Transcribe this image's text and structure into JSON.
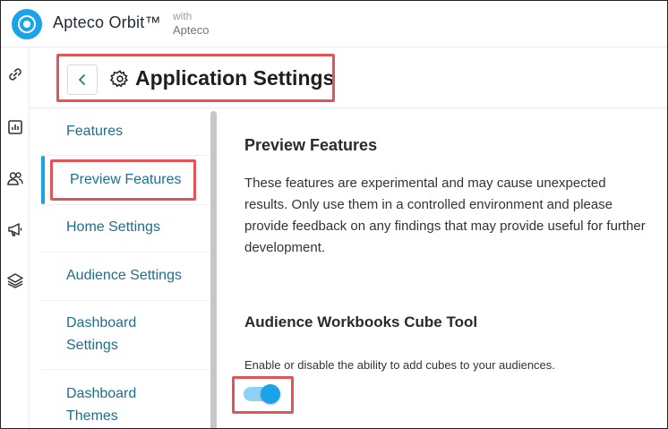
{
  "app": {
    "brand": "Apteco Orbit™",
    "with_label": "with",
    "with_brand": "Apteco",
    "accent_color": "#1aa3e8",
    "highlight_color": "#e05656"
  },
  "rail": {
    "icons": [
      "link-icon",
      "chart-icon",
      "users-icon",
      "megaphone-icon",
      "layers-icon"
    ]
  },
  "header": {
    "back_icon": "chevron-left-icon",
    "settings_icon": "gear-icon",
    "title": "Application Settings"
  },
  "nav": {
    "items": [
      {
        "label": "Features",
        "active": false
      },
      {
        "label": "Preview Features",
        "active": true
      },
      {
        "label": "Home Settings",
        "active": false
      },
      {
        "label": "Audience Settings",
        "active": false
      },
      {
        "label_line1": "Dashboard",
        "label_line2": "Settings",
        "active": false
      },
      {
        "label_line1": "Dashboard",
        "label_line2": "Themes",
        "active": false
      }
    ]
  },
  "content": {
    "section_title": "Preview Features",
    "description": "These features are experimental and may cause unexpected results. Only use them in a controlled environment and please provide feedback on any findings that may provide useful for further development.",
    "feature_title": "Audience Workbooks Cube Tool",
    "feature_description": "Enable or disable the ability to add cubes to your audiences.",
    "feature_enabled": true
  }
}
